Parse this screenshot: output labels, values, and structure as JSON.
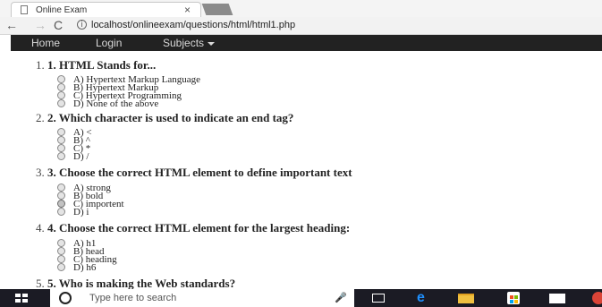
{
  "browser": {
    "tab_title": "Online Exam",
    "tab_close": "×",
    "url": "localhost/onlineexam/questions/html/html1.php",
    "back_glyph": "←",
    "forward_glyph": "→",
    "reload_glyph": "C",
    "info_glyph": "i"
  },
  "nav": {
    "home": "Home",
    "login": "Login",
    "subjects": "Subjects"
  },
  "questions": [
    {
      "num": "1.",
      "text": "1. HTML Stands for...",
      "options": [
        "A) Hypertext Markup Language",
        "B) Hypertext Markup",
        "C) Hypertext Programming",
        "D) None of the above"
      ]
    },
    {
      "num": "2.",
      "text": "2. Which character is used to indicate an end tag?",
      "options": [
        "A) <",
        "B) ^",
        "C) *",
        "D) /"
      ]
    },
    {
      "num": "3.",
      "text": "3. Choose the correct HTML element to define important text",
      "options": [
        "A) strong",
        "B) bold",
        "C) importent",
        "D) i"
      ],
      "selected": 2
    },
    {
      "num": "4.",
      "text": "4. Choose the correct HTML element for the largest heading:",
      "options": [
        "A) h1",
        "B) head",
        "C) heading",
        "D) h6"
      ]
    },
    {
      "num": "5.",
      "text": "5. Who is making the Web standards?",
      "options": []
    }
  ],
  "taskbar": {
    "search_placeholder": "Type here to search",
    "mic_glyph": "🎤",
    "edge_glyph": "e"
  },
  "colors": {
    "navbar_bg": "#222222",
    "taskbar_bg": "#1b1b24"
  }
}
